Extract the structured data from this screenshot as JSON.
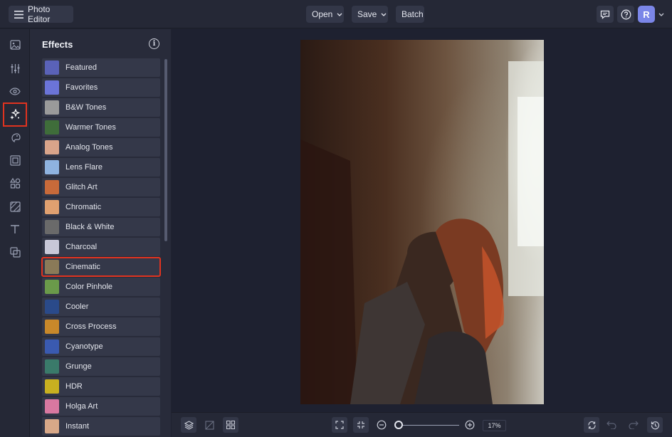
{
  "header": {
    "app_title": "Photo Editor",
    "open_label": "Open",
    "save_label": "Save",
    "batch_label": "Batch",
    "avatar_initial": "R"
  },
  "rail": {
    "items": [
      "image-icon",
      "adjust-sliders-icon",
      "eye-icon",
      "effects-sparkle-icon",
      "touch-up-icon",
      "frame-icon",
      "graphics-icon",
      "texture-icon",
      "text-icon",
      "overlay-icon"
    ],
    "active": "effects-sparkle-icon"
  },
  "effects_panel": {
    "title": "Effects",
    "items": [
      {
        "label": "Featured",
        "thumb": "#5a62b8"
      },
      {
        "label": "Favorites",
        "thumb": "#6b74d8"
      },
      {
        "label": "B&W Tones",
        "thumb": "#9a9a9a"
      },
      {
        "label": "Warmer Tones",
        "thumb": "#3f6d3a"
      },
      {
        "label": "Analog Tones",
        "thumb": "#d9a48a"
      },
      {
        "label": "Lens Flare",
        "thumb": "#8fb3e0"
      },
      {
        "label": "Glitch Art",
        "thumb": "#c86a3a"
      },
      {
        "label": "Chromatic",
        "thumb": "#e0a070"
      },
      {
        "label": "Black & White",
        "thumb": "#6a6a6a"
      },
      {
        "label": "Charcoal",
        "thumb": "#c8c8d8"
      },
      {
        "label": "Cinematic",
        "thumb": "#8a7a58"
      },
      {
        "label": "Color Pinhole",
        "thumb": "#6a9a4a"
      },
      {
        "label": "Cooler",
        "thumb": "#2a4a8a"
      },
      {
        "label": "Cross Process",
        "thumb": "#c8882a"
      },
      {
        "label": "Cyanotype",
        "thumb": "#3a5ab0"
      },
      {
        "label": "Grunge",
        "thumb": "#3a7a6a"
      },
      {
        "label": "HDR",
        "thumb": "#c8b020"
      },
      {
        "label": "Holga Art",
        "thumb": "#d878a0"
      },
      {
        "label": "Instant",
        "thumb": "#d8a888"
      }
    ],
    "selected": "Cinematic"
  },
  "bottom": {
    "zoom": "17%"
  },
  "colors": {
    "accent_highlight": "#e0331f",
    "avatar": "#7b86e8"
  }
}
